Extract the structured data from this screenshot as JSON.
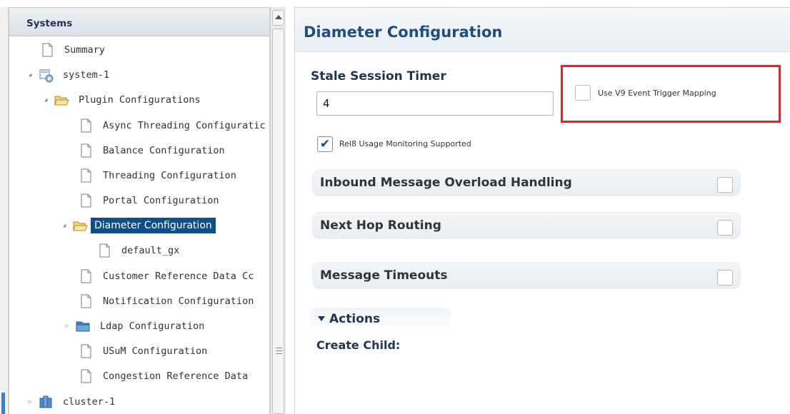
{
  "tree": {
    "header": "Systems",
    "items": [
      {
        "label": "Summary",
        "icon": "document-icon"
      },
      {
        "label": "system-1",
        "icon": "system-icon"
      },
      {
        "label": "Plugin Configurations",
        "icon": "folder-open-icon"
      },
      {
        "label": "Async Threading Configuratic",
        "icon": "document-icon"
      },
      {
        "label": "Balance Configuration",
        "icon": "document-icon"
      },
      {
        "label": "Threading Configuration",
        "icon": "document-icon"
      },
      {
        "label": "Portal Configuration",
        "icon": "document-icon"
      },
      {
        "label": "Diameter Configuration",
        "icon": "folder-open-icon"
      },
      {
        "label": "default_gx",
        "icon": "document-icon"
      },
      {
        "label": "Customer Reference Data Cc",
        "icon": "document-icon"
      },
      {
        "label": "Notification Configuration",
        "icon": "document-icon"
      },
      {
        "label": "Ldap Configuration",
        "icon": "folder-closed-icon"
      },
      {
        "label": "USuM Configuration",
        "icon": "document-icon"
      },
      {
        "label": "Congestion Reference Data",
        "icon": "document-icon"
      },
      {
        "label": "cluster-1",
        "icon": "cluster-icon"
      }
    ]
  },
  "main": {
    "title": "Diameter Configuration",
    "stale_session": {
      "label": "Stale Session Timer",
      "value": "4"
    },
    "v9_mapping": {
      "label": "Use V9 Event Trigger Mapping",
      "checked": false
    },
    "rel8": {
      "label": "Rel8 Usage Monitoring Supported",
      "checked": true
    },
    "sections": [
      {
        "label": "Inbound Message Overload Handling"
      },
      {
        "label": "Next Hop Routing"
      },
      {
        "label": "Message Timeouts"
      }
    ],
    "actions": {
      "label": "Actions",
      "create_child": "Create Child:"
    }
  },
  "colors": {
    "selected": "#0d4f8a",
    "accent": "#1e4f80",
    "highlight": "#e3242b"
  }
}
